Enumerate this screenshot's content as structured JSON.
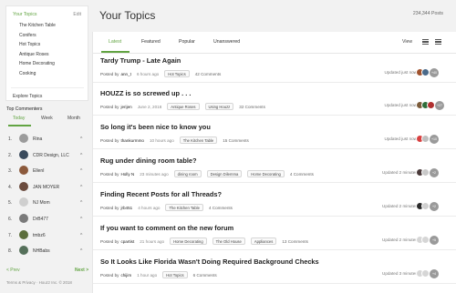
{
  "sidebar": {
    "topics_heading": "Your Topics",
    "edit_label": "Edit",
    "topics": [
      "The Kitchen Table",
      "Conifers",
      "Hot Topics",
      "Antique Roses",
      "Home Decorating",
      "Cooking"
    ],
    "explore_label": "Explore Topics",
    "commenters_title": "Top Commenters",
    "commenter_tabs": [
      "Today",
      "Week",
      "Month"
    ],
    "commenter_tab_active": "Today",
    "commenters": [
      {
        "rank": "1.",
        "name": "Rina",
        "color": "#9b9b9b"
      },
      {
        "rank": "2.",
        "name": "CDR Design, LLC",
        "color": "#3a4a5c"
      },
      {
        "rank": "3.",
        "name": "EllenI",
        "color": "#8c5a3c"
      },
      {
        "rank": "4.",
        "name": "JAN MOYER",
        "color": "#6b4b3e"
      },
      {
        "rank": "5.",
        "name": "NJ Mom",
        "color": "#cfcfcf"
      },
      {
        "rank": "6.",
        "name": "DrB477",
        "color": "#7a7a7a"
      },
      {
        "rank": "7.",
        "name": "tmbz6",
        "color": "#5c6e3c"
      },
      {
        "rank": "8.",
        "name": "NHBabs",
        "color": "#55705a"
      }
    ],
    "caret_glyph": "^",
    "prev_label": "< Prev",
    "next_label": "Next >",
    "footer": "Terms & Privacy · Houzz Inc. © 2018"
  },
  "main": {
    "title": "Your Topics",
    "posts_count": "234,344 Posts",
    "tabs": [
      "Latest",
      "Featured",
      "Popular",
      "Unanswered"
    ],
    "active_tab": "Latest",
    "view_label": "View",
    "view_modes": [
      "list-view-icon",
      "grid-view-icon"
    ],
    "threads": [
      {
        "title": "Tardy Trump - Late Again",
        "posted_by": "Posted by",
        "author": "ann_t",
        "time": "6 hours ago",
        "tags": [
          "Hot Topics"
        ],
        "comments": "42 Comments",
        "updated": "Updated just now",
        "avatar_colors": [
          "#a0522d",
          "#4a6a8a"
        ],
        "more": "+40"
      },
      {
        "title": "HOUZZ is so screwed up . . .",
        "posted_by": "Posted by",
        "author": "jerijen",
        "time": "June 2, 2018",
        "tags": [
          "Antique Roses",
          "Using Houzz"
        ],
        "comments": "32 Comments",
        "updated": "Updated just now",
        "avatar_colors": [
          "#7b5b3a",
          "#2e6d3a",
          "#b03030"
        ],
        "more": "+27"
      },
      {
        "title": "So long it's been nice to know you",
        "posted_by": "Posted by",
        "author": "thankurmmo",
        "time": "10 hours ago",
        "tags": [
          "The Kitchen Table"
        ],
        "comments": "15 Comments",
        "updated": "Updated just now",
        "avatar_colors": [
          "#d84040",
          "#bfbfbf"
        ],
        "more": "+10"
      },
      {
        "title": "Rug under dining room table?",
        "posted_by": "Posted by",
        "author": "Holly N",
        "time": "23 minutes ago",
        "tags": [
          "dining room",
          "Design Dilemma",
          "Home Decorating"
        ],
        "comments": "4 Comments",
        "updated": "Updated 2 minutes ago",
        "avatar_colors": [
          "#4a3a3a",
          "#c9c9c9"
        ],
        "more": "+2"
      },
      {
        "title": "Finding Recent Posts for all Threads?",
        "posted_by": "Posted by",
        "author": "jrb451",
        "time": "4 hours ago",
        "tags": [
          "The Kitchen Table"
        ],
        "comments": "4 Comments",
        "updated": "Updated 2 minutes ago",
        "avatar_colors": [
          "#2b2b2b",
          "#d0d0d0"
        ],
        "more": "+2"
      },
      {
        "title": "If you want to comment on the new forum",
        "posted_by": "Posted by",
        "author": "cpartist",
        "time": "21 hours ago",
        "tags": [
          "Home Decorating",
          "The Old House",
          "Appliances"
        ],
        "comments": "13 Comments",
        "updated": "Updated 2 minutes ago",
        "avatar_colors": [
          "#d6d6d6",
          "#d6d6d6"
        ],
        "more": "+5"
      },
      {
        "title": "So It Looks Like Florida Wasn't Doing Required Background Checks",
        "posted_by": "Posted by",
        "author": "chijim",
        "time": "1 hour ago",
        "tags": [
          "Hot Topics"
        ],
        "comments": "6 Comments",
        "updated": "Updated 3 minutes ago",
        "avatar_colors": [
          "#d6d6d6",
          "#d6d6d6"
        ],
        "more": "+4"
      }
    ]
  },
  "colors": {
    "accent": "#62a442",
    "text": "#222222",
    "background": "#f2f2f2"
  },
  "icons": {
    "image_icon": "picture-icon",
    "tag_icon": "tag-label"
  }
}
